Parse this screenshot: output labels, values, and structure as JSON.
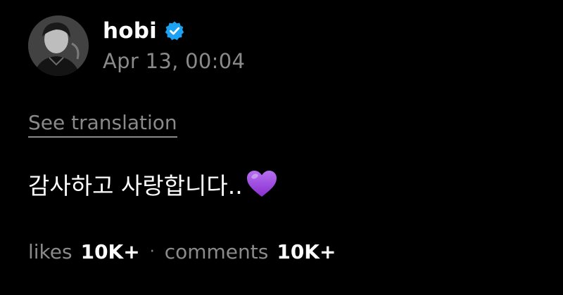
{
  "post": {
    "author": {
      "username": "hobi",
      "verified": true,
      "verified_color": "#1da1f2",
      "avatar_icon": "profile-photo"
    },
    "timestamp": "Apr 13, 00:04",
    "translate_label": "See translation",
    "text": "감사하고 사랑합니다..",
    "emoji": "purple-heart",
    "emoji_color": "#9b4bd9",
    "stats": {
      "likes_label": "likes",
      "likes_value": "10K+",
      "separator": "·",
      "comments_label": "comments",
      "comments_value": "10K+"
    }
  }
}
